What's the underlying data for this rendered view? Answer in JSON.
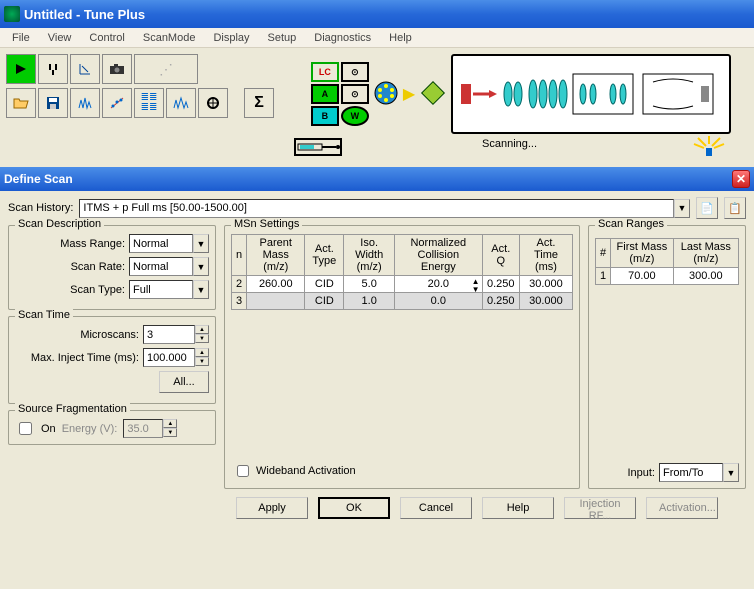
{
  "window_title": "Untitled - Tune Plus",
  "menu": [
    "File",
    "View",
    "Control",
    "ScanMode",
    "Display",
    "Setup",
    "Diagnostics",
    "Help"
  ],
  "status_text": "Scanning...",
  "panel_title": "Define Scan",
  "scan_history": {
    "label": "Scan History:",
    "value": "ITMS + p Full ms [50.00-1500.00]"
  },
  "scan_description": {
    "legend": "Scan Description",
    "mass_range": {
      "label": "Mass Range:",
      "value": "Normal"
    },
    "scan_rate": {
      "label": "Scan Rate:",
      "value": "Normal"
    },
    "scan_type": {
      "label": "Scan Type:",
      "value": "Full"
    }
  },
  "scan_time": {
    "legend": "Scan Time",
    "microscans": {
      "label": "Microscans:",
      "value": "3"
    },
    "max_inject": {
      "label": "Max. Inject Time (ms):",
      "value": "100.000"
    },
    "all_btn": "All..."
  },
  "source_frag": {
    "legend": "Source Fragmentation",
    "on_label": "On",
    "energy_label": "Energy (V):",
    "energy_value": "35.0"
  },
  "msn": {
    "legend": "MSn Settings",
    "headers": [
      "n",
      "Parent Mass (m/z)",
      "Act. Type",
      "Iso. Width (m/z)",
      "Normalized Collision Energy",
      "Act. Q",
      "Act. Time (ms)"
    ],
    "rows": [
      {
        "n": "2",
        "parent": "260.00",
        "act_type": "CID",
        "iso": "5.0",
        "nce": "20.0",
        "actq": "0.250",
        "act_time": "30.000"
      },
      {
        "n": "3",
        "parent": "",
        "act_type": "CID",
        "iso": "1.0",
        "nce": "0.0",
        "actq": "0.250",
        "act_time": "30.000"
      }
    ],
    "wideband_label": "Wideband Activation"
  },
  "scan_ranges": {
    "legend": "Scan Ranges",
    "headers": [
      "#",
      "First Mass (m/z)",
      "Last Mass (m/z)"
    ],
    "rows": [
      {
        "i": "1",
        "first": "70.00",
        "last": "300.00"
      }
    ],
    "input_label": "Input:",
    "input_value": "From/To"
  },
  "buttons": {
    "apply": "Apply",
    "ok": "OK",
    "cancel": "Cancel",
    "help": "Help",
    "injection_rf": "Injection RF...",
    "activation": "Activation..."
  },
  "lc_labels": {
    "lc": "LC",
    "a": "A",
    "b": "B",
    "w": "W"
  }
}
